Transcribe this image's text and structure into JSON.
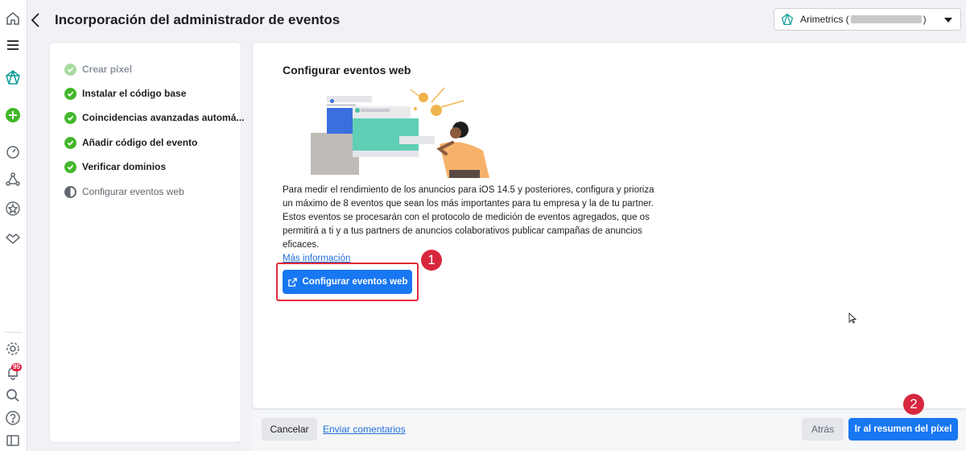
{
  "header": {
    "title": "Incorporación del administrador de eventos",
    "account_name": "Arimetrics ("
  },
  "nav": {
    "notification_count": "95"
  },
  "steps": [
    {
      "label": "Crear píxel",
      "state": "done-faded"
    },
    {
      "label": "Instalar el código base",
      "state": "done"
    },
    {
      "label": "Coincidencias avanzadas automá...",
      "state": "done"
    },
    {
      "label": "Añadir código del evento",
      "state": "done"
    },
    {
      "label": "Verificar dominios",
      "state": "done"
    },
    {
      "label": "Configurar eventos web",
      "state": "current"
    }
  ],
  "main": {
    "heading": "Configurar eventos web",
    "description": "Para medir el rendimiento de los anuncios para iOS 14.5 y posteriores, configura y prioriza un máximo de 8 eventos que sean los más importantes para tu empresa y la de tu partner. Estos eventos se procesarán con el protocolo de medición de eventos agregados, que os permitirá a ti y a tus partners de anuncios colaborativos publicar campañas de anuncios eficaces.",
    "more_link": "Más información",
    "configure_button": "Configurar eventos web"
  },
  "annotations": {
    "marker_1": "1",
    "marker_2": "2"
  },
  "footer": {
    "cancel": "Cancelar",
    "feedback": "Enviar comentarios",
    "back": "Atrás",
    "next": "Ir al resumen del píxel"
  },
  "colors": {
    "primary": "#1877f2",
    "success": "#42b72a",
    "annotation": "#d7263d"
  }
}
